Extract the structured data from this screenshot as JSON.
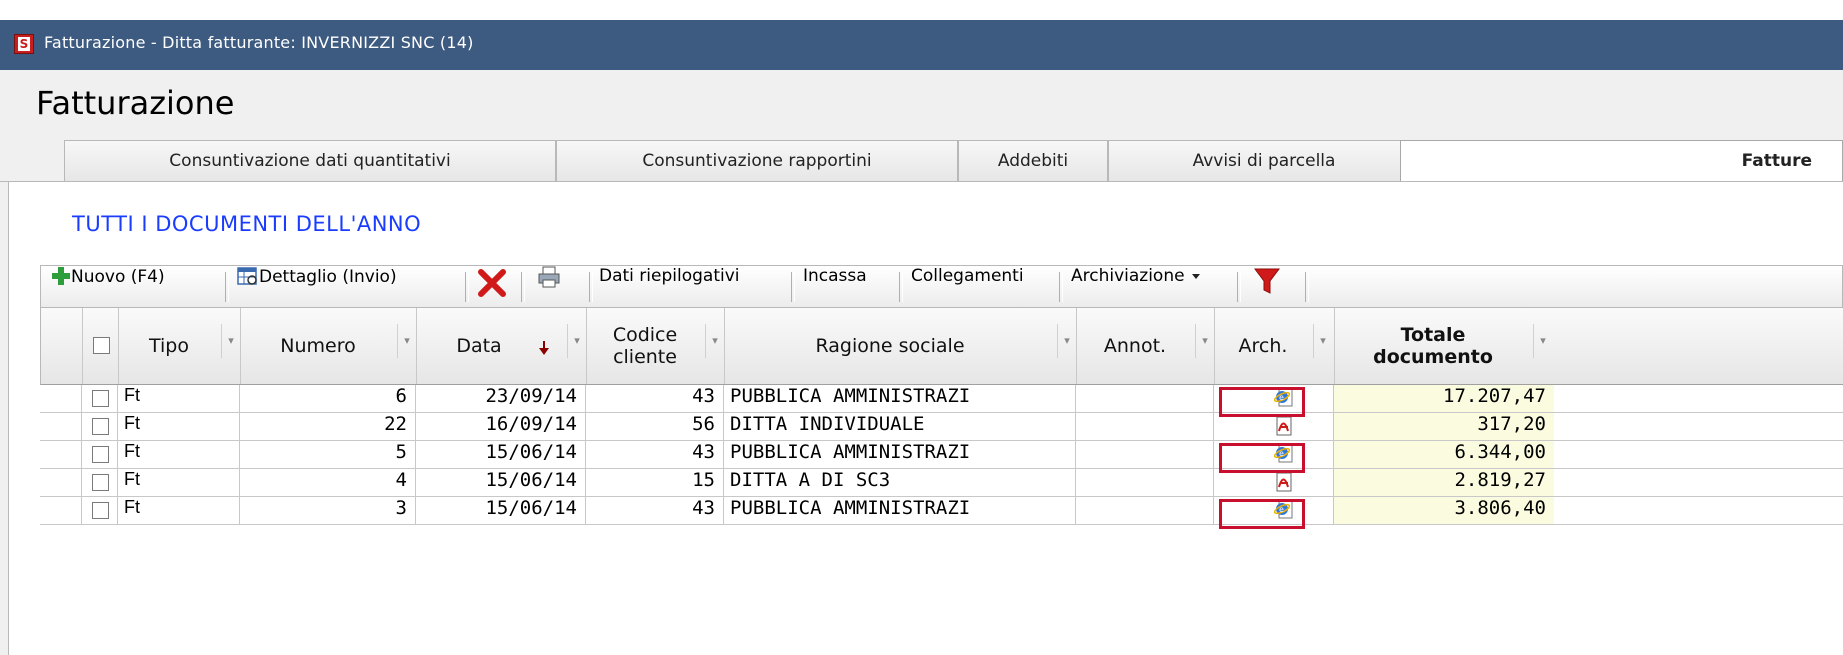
{
  "window": {
    "title": "Fatturazione - Ditta fatturante: INVERNIZZI SNC (14)"
  },
  "page": {
    "title": "Fatturazione"
  },
  "tabs": [
    {
      "label": "Consuntivazione dati quantitativi"
    },
    {
      "label": "Consuntivazione rapportini"
    },
    {
      "label": "Addebiti"
    },
    {
      "label": "Avvisi di parcella"
    },
    {
      "label": "Fatture",
      "active": true
    }
  ],
  "section": {
    "title": "TUTTI I DOCUMENTI DELL'ANNO"
  },
  "toolbar": {
    "new_label": "Nuovo (F4)",
    "detail_label": "Dettaglio (Invio)",
    "summary_label": "Dati riepilogativi",
    "collect_label": "Incassa",
    "links_label": "Collegamenti",
    "archive_label": "Archiviazione"
  },
  "columns": {
    "tipo": "Tipo",
    "numero": "Numero",
    "data": "Data",
    "codice_1": "Codice",
    "codice_2": "cliente",
    "ragione": "Ragione sociale",
    "annot": "Annot.",
    "arch": "Arch.",
    "totale_1": "Totale",
    "totale_2": "documento"
  },
  "rows": [
    {
      "tipo": "Ft",
      "numero": "6",
      "data": "23/09/14",
      "codice": "43",
      "ragione": "PUBBLICA AMMINISTRAZI",
      "arch": "ie-icon",
      "highlighted": true,
      "totale": "17.207,47"
    },
    {
      "tipo": "Ft",
      "numero": "22",
      "data": "16/09/14",
      "codice": "56",
      "ragione": "DITTA INDIVIDUALE",
      "arch": "pdf-icon",
      "highlighted": false,
      "totale": "317,20"
    },
    {
      "tipo": "Ft",
      "numero": "5",
      "data": "15/06/14",
      "codice": "43",
      "ragione": "PUBBLICA AMMINISTRAZI",
      "arch": "ie-icon",
      "highlighted": true,
      "totale": "6.344,00"
    },
    {
      "tipo": "Ft",
      "numero": "4",
      "data": "15/06/14",
      "codice": "15",
      "ragione": "DITTA A DI SC3",
      "arch": "pdf-icon",
      "highlighted": false,
      "totale": "2.819,27"
    },
    {
      "tipo": "Ft",
      "numero": "3",
      "data": "15/06/14",
      "codice": "43",
      "ragione": "PUBBLICA AMMINISTRAZI",
      "arch": "ie-icon",
      "highlighted": true,
      "totale": "3.806,40"
    }
  ],
  "colors": {
    "titlebar": "#3d5a80",
    "section": "#1a3cff",
    "highlight": "#c8102e",
    "total_bg": "#fbfbe0"
  }
}
